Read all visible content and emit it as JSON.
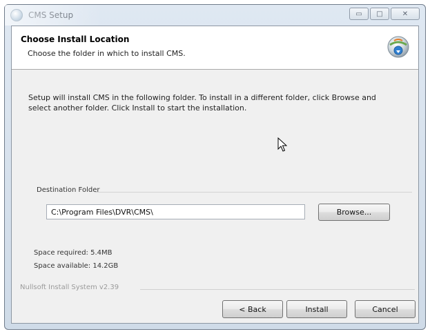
{
  "window": {
    "title": "CMS Setup",
    "controls": {
      "minimize": "▭",
      "maximize": "□",
      "close": "✕"
    }
  },
  "header": {
    "title": "Choose Install Location",
    "subtitle": "Choose the folder in which to install CMS."
  },
  "body": {
    "description": "Setup will install CMS in the following folder. To install in a different folder, click Browse and select another folder. Click Install to start the installation."
  },
  "destination": {
    "group_label": "Destination Folder",
    "path_value": "C:\\Program Files\\DVR\\CMS\\",
    "browse_label": "Browse..."
  },
  "space": {
    "required": "Space required: 5.4MB",
    "available": "Space available: 14.2GB"
  },
  "footer": {
    "brand": "Nullsoft Install System v2.39",
    "back_label": "< Back",
    "install_label": "Install",
    "cancel_label": "Cancel"
  },
  "icons": {
    "app": "setup-disc-icon",
    "header": "installer-globe-icon",
    "cursor": "mouse-pointer-icon"
  },
  "colors": {
    "titlebar": "#d7e2ee",
    "client_bg": "#f0f0f0",
    "header_bg": "#ffffff",
    "brand_text": "#9a9a9a"
  }
}
